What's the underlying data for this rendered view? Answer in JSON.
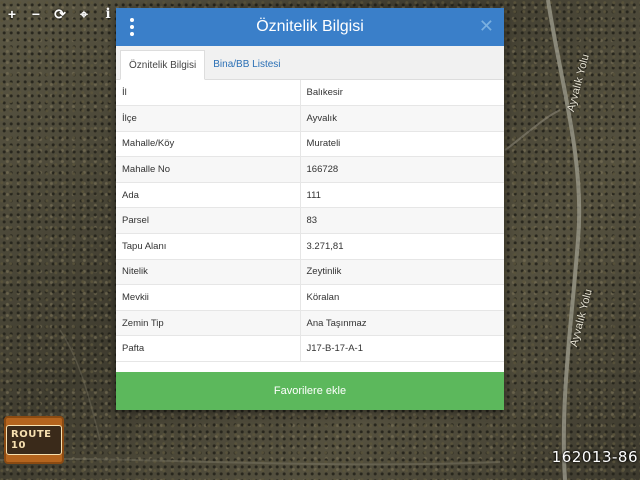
{
  "map": {
    "road_label_1": "Ayvalık Yolu",
    "road_label_2": "Ayvalık Yolu"
  },
  "toolbar": {
    "zoom_in_icon": "plus-icon",
    "zoom_out_icon": "minus-icon",
    "refresh_icon": "refresh-icon",
    "locate_icon": "crosshair-icon",
    "info_icon": "info-icon"
  },
  "modal": {
    "title": "Öznitelik Bilgisi",
    "menu_icon": "kebab-icon",
    "close_icon": "close-icon",
    "tabs": [
      {
        "label": "Öznitelik Bilgisi",
        "active": true
      },
      {
        "label": "Bina/BB Listesi",
        "active": false
      }
    ],
    "rows": [
      {
        "key": "İl",
        "value": "Balıkesir"
      },
      {
        "key": "İlçe",
        "value": "Ayvalık"
      },
      {
        "key": "Mahalle/Köy",
        "value": "Murateli"
      },
      {
        "key": "Mahalle No",
        "value": "166728"
      },
      {
        "key": "Ada",
        "value": "111"
      },
      {
        "key": "Parsel",
        "value": "83"
      },
      {
        "key": "Tapu Alanı",
        "value": "3.271,81"
      },
      {
        "key": "Nitelik",
        "value": "Zeytinlik"
      },
      {
        "key": "Mevkii",
        "value": "Köralan"
      },
      {
        "key": "Zemin Tip",
        "value": "Ana Taşınmaz"
      },
      {
        "key": "Pafta",
        "value": "J17-B-17-A-1"
      }
    ],
    "favorite_button": "Favorilere ekle"
  },
  "logo_text": "ROUTE 10",
  "listing_code": "162013-86",
  "colors": {
    "header": "#3a7fc9",
    "button": "#5cb85c",
    "tab_link": "#2a6fb5"
  }
}
